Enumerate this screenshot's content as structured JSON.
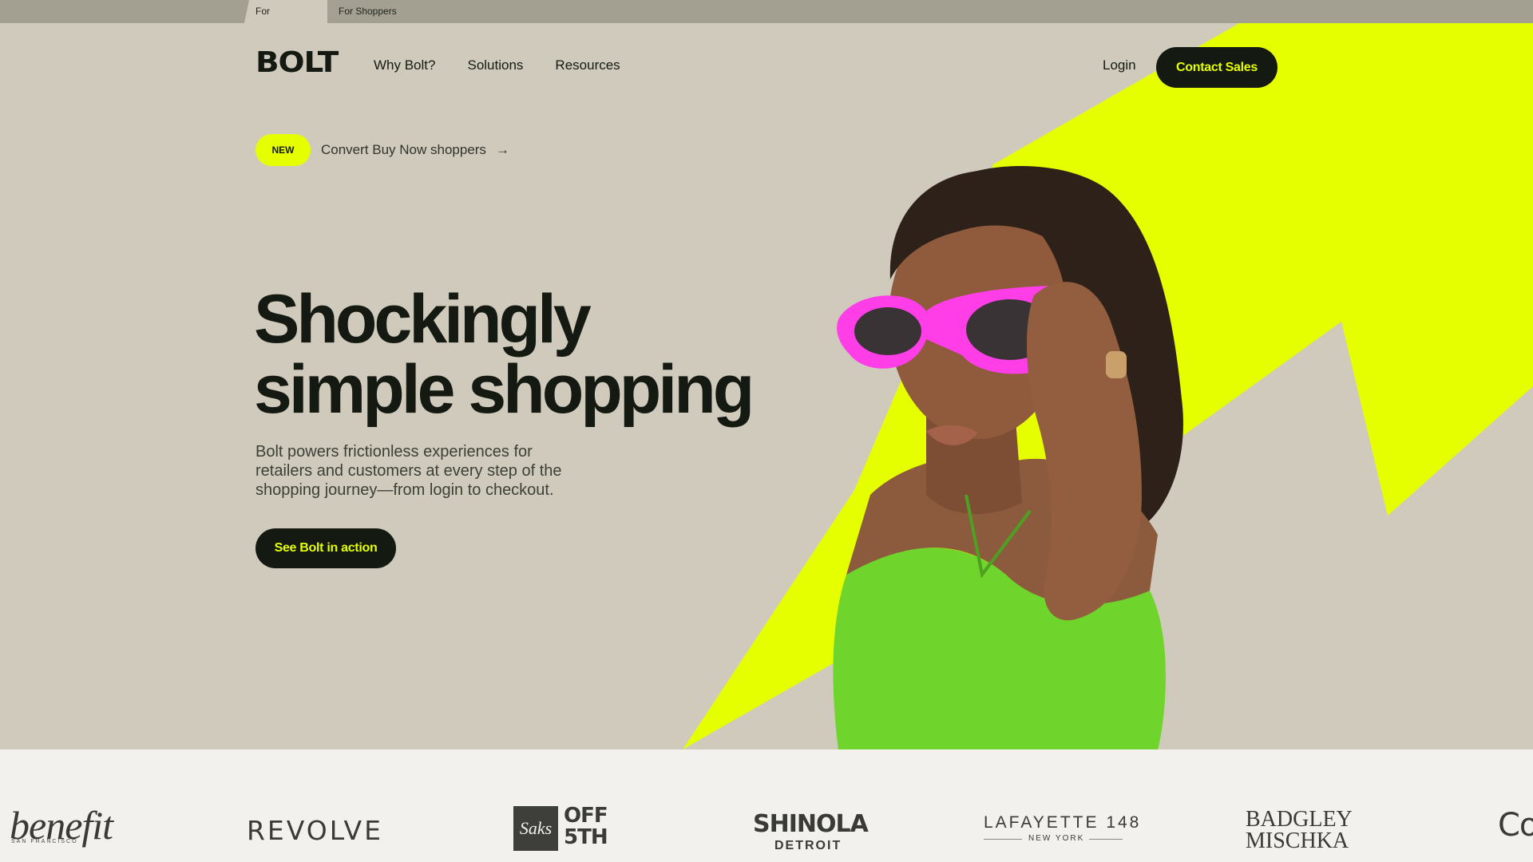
{
  "topbar": {
    "tabs": [
      {
        "label": "For Merchants",
        "active": true
      },
      {
        "label": "For Shoppers",
        "active": false
      }
    ]
  },
  "nav": {
    "logo": "BOLT",
    "links": [
      "Why Bolt?",
      "Solutions",
      "Resources"
    ],
    "login": "Login",
    "contact": "Contact Sales"
  },
  "announcement": {
    "badge": "NEW",
    "text": "Convert Buy Now shoppers",
    "arrow": "→"
  },
  "hero": {
    "headline_line1": "Shockingly",
    "headline_line2": "simple shopping",
    "subcopy": "Bolt powers frictionless experiences for retailers and customers at every step of the shopping journey—from login to checkout.",
    "cta": "See Bolt in action"
  },
  "brands": {
    "benefit": "benefit",
    "benefit_sub": "SAN FRANCISCO",
    "revolve": "REVOLVE",
    "saks_mark": "Saks",
    "off5th_line1": "OFF",
    "off5th_line2": "5TH",
    "shinola": "SHINOLA",
    "shinola_sub": "DETROIT",
    "lafayette": "LAFAYETTE 148",
    "lafayette_sub": "NEW YORK",
    "badgley_line1": "BADGLEY",
    "badgley_line2": "MISCHKA",
    "partial": "Co"
  },
  "colors": {
    "background": "#d0cabd",
    "accent": "#e5ff00",
    "dark": "#141a12",
    "strip": "#f2f1ed",
    "sunglasses": "#ff3ee8",
    "dress": "#6fd42c"
  },
  "icons": {
    "announcement_arrow": "arrow-right-icon"
  }
}
